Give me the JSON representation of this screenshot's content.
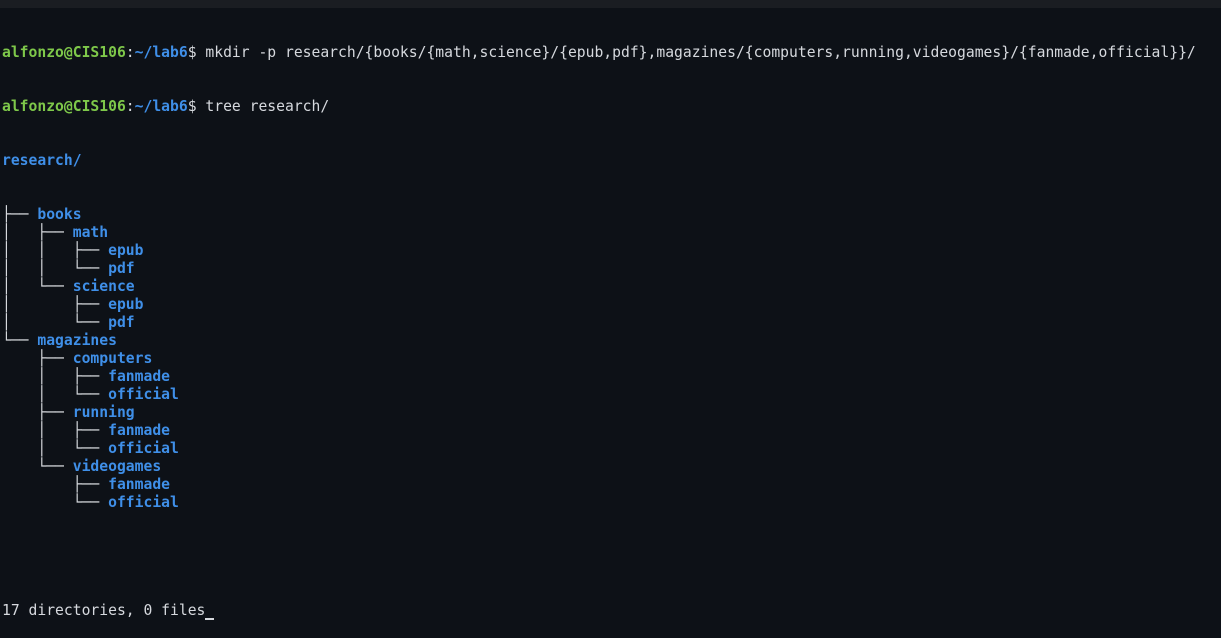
{
  "prompt": {
    "user": "alfonzo@CIS106",
    "sep": ":",
    "path": "~/lab6",
    "dollar": "$ "
  },
  "commands": [
    "mkdir -p research/{books/{math,science}/{epub,pdf},magazines/{computers,running,videogames}/{fanmade,official}}/",
    "tree research/"
  ],
  "tree": {
    "root": "research/",
    "lines": [
      {
        "prefix": "├── ",
        "name": "books"
      },
      {
        "prefix": "│   ├── ",
        "name": "math"
      },
      {
        "prefix": "│   │   ├── ",
        "name": "epub"
      },
      {
        "prefix": "│   │   └── ",
        "name": "pdf"
      },
      {
        "prefix": "│   └── ",
        "name": "science"
      },
      {
        "prefix": "│       ├── ",
        "name": "epub"
      },
      {
        "prefix": "│       └── ",
        "name": "pdf"
      },
      {
        "prefix": "└── ",
        "name": "magazines"
      },
      {
        "prefix": "    ├── ",
        "name": "computers"
      },
      {
        "prefix": "    │   ├── ",
        "name": "fanmade"
      },
      {
        "prefix": "    │   └── ",
        "name": "official"
      },
      {
        "prefix": "    ├── ",
        "name": "running"
      },
      {
        "prefix": "    │   ├── ",
        "name": "fanmade"
      },
      {
        "prefix": "    │   └── ",
        "name": "official"
      },
      {
        "prefix": "    └── ",
        "name": "videogames"
      },
      {
        "prefix": "        ├── ",
        "name": "fanmade"
      },
      {
        "prefix": "        └── ",
        "name": "official"
      }
    ]
  },
  "summary": "17 directories, 0 files",
  "colors": {
    "background": "#0d1117",
    "prompt_user": "#7ec84a",
    "directory": "#3f8fe8",
    "text": "#d6d9de"
  }
}
